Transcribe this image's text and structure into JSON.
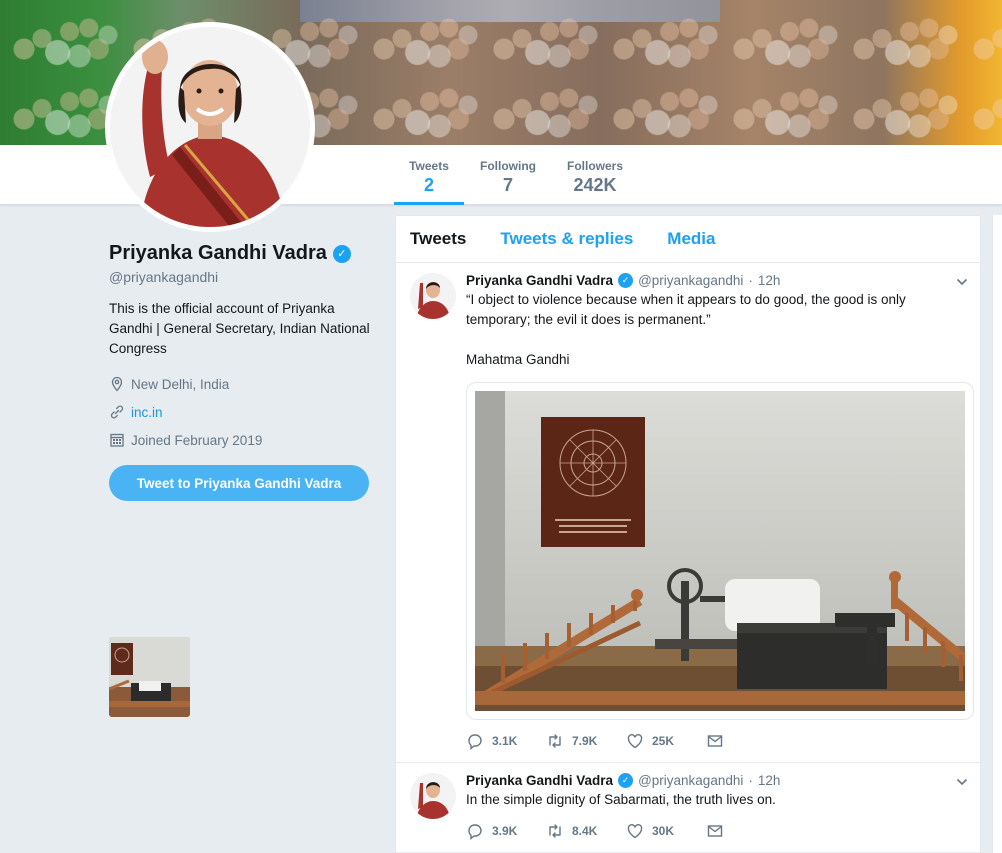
{
  "profile": {
    "name": "Priyanka Gandhi Vadra",
    "handle": "@priyankagandhi",
    "bio": "This is the official account of Priyanka Gandhi | General Secretary, Indian National Congress",
    "location": "New Delhi, India",
    "website": "inc.in",
    "joined": "Joined February 2019",
    "tweet_to_label": "Tweet to Priyanka Gandhi Vadra"
  },
  "stats": {
    "tweets_label": "Tweets",
    "tweets_value": "2",
    "following_label": "Following",
    "following_value": "7",
    "followers_label": "Followers",
    "followers_value": "242K"
  },
  "timeline_tabs": [
    "Tweets",
    "Tweets & replies",
    "Media"
  ],
  "tweets": [
    {
      "name": "Priyanka Gandhi Vadra",
      "handle": "@priyankagandhi",
      "dot": "·",
      "time": "12h",
      "text": "“I object to violence because when it appears to do good, the good is only temporary; the evil it does is permanent.”\n\nMahatma Gandhi",
      "replies": "3.1K",
      "retweets": "7.9K",
      "likes": "25K"
    },
    {
      "name": "Priyanka Gandhi Vadra",
      "handle": "@priyankagandhi",
      "dot": "·",
      "time": "12h",
      "text": "In the simple dignity of Sabarmati, the truth lives on.",
      "replies": "3.9K",
      "retweets": "8.4K",
      "likes": "30K"
    }
  ],
  "colors": {
    "accent": "#1da1f2",
    "button": "#4ab3f4",
    "muted": "#657786",
    "background": "#e6ecf0"
  },
  "icons": [
    "verified-icon",
    "location-icon",
    "link-icon",
    "calendar-icon",
    "reply-icon",
    "retweet-icon",
    "like-icon",
    "dm-icon",
    "chevron-down-icon"
  ]
}
